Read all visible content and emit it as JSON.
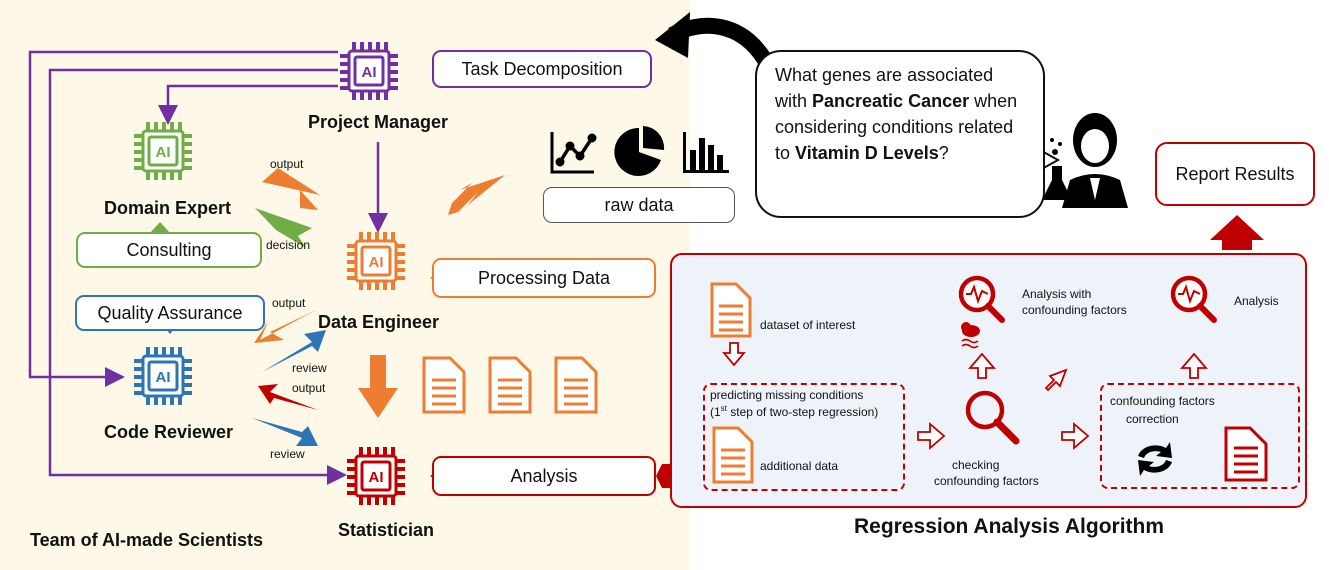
{
  "question": {
    "part1": "What genes are associated with ",
    "bold1": "Pancreatic Cancer",
    "part2": " when considering conditions related to ",
    "bold2": "Vitamin D Levels",
    "part3": "?"
  },
  "agents": {
    "project_manager": "Project Manager",
    "domain_expert": "Domain Expert",
    "data_engineer": "Data Engineer",
    "code_reviewer": "Code Reviewer",
    "statistician": "Statistician",
    "chip_label": "AI"
  },
  "tasks": {
    "task_decomposition": "Task Decomposition",
    "consulting": "Consulting",
    "quality_assurance": "Quality Assurance",
    "processing_data": "Processing Data",
    "analysis": "Analysis",
    "raw_data": "raw data",
    "report_results": "Report Results"
  },
  "edge_labels": {
    "output1": "output",
    "decision": "decision",
    "output2": "output",
    "review1": "review",
    "output3": "output",
    "review2": "review"
  },
  "algorithm": {
    "dataset_of_interest": "dataset of interest",
    "predicting_line1": "predicting missing conditions",
    "predicting_line2_pre": "(1",
    "predicting_line2_sup": "st",
    "predicting_line2_post": " step of two-step regression)",
    "additional_data": "additional data",
    "checking_line1": "checking",
    "checking_line2": "confounding factors",
    "analysis_cf_line1": "Analysis with",
    "analysis_cf_line2": "confounding factors",
    "analysis": "Analysis",
    "cf_correction_line1": "confounding factors",
    "cf_correction_line2": "correction"
  },
  "titles": {
    "team": "Team of AI-made Scientists",
    "algorithm": "Regression Analysis Algorithm"
  },
  "colors": {
    "purple": "#7030a0",
    "green": "#70ad47",
    "blue": "#2e75b6",
    "orange": "#ed7d31",
    "red": "#c00000"
  }
}
